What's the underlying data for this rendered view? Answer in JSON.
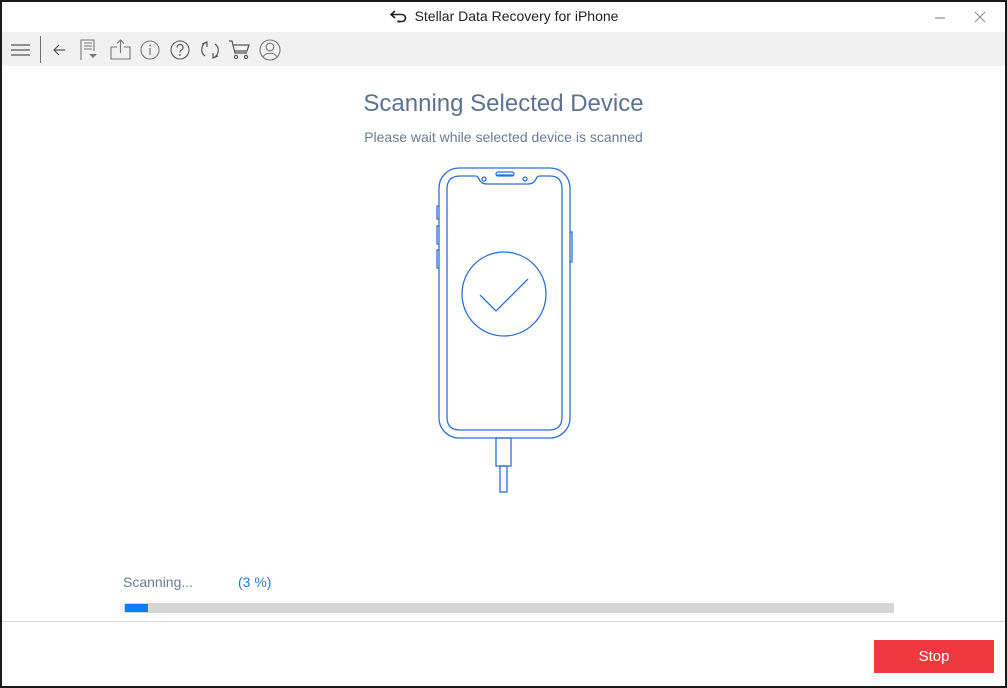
{
  "window": {
    "title": "Stellar Data Recovery for iPhone",
    "controls": [
      "minimize",
      "close"
    ]
  },
  "toolbar": {
    "items": [
      {
        "name": "menu",
        "icon": "hamburger-menu-icon"
      },
      {
        "name": "back",
        "icon": "arrow-left-icon"
      },
      {
        "name": "save-scan",
        "icon": "save-scan-icon"
      },
      {
        "name": "export",
        "icon": "export-icon"
      },
      {
        "name": "info",
        "icon": "info-icon"
      },
      {
        "name": "help",
        "icon": "help-icon"
      },
      {
        "name": "refresh",
        "icon": "refresh-icon"
      },
      {
        "name": "buy",
        "icon": "cart-icon"
      },
      {
        "name": "account",
        "icon": "user-icon"
      }
    ]
  },
  "main": {
    "heading": "Scanning Selected Device",
    "subheading": "Please wait while selected device is scanned",
    "illustration": "iphone-with-checkmark-icon"
  },
  "progress": {
    "label": "Scanning...",
    "percent_text": "(3 %)",
    "value_percent": 3
  },
  "footer": {
    "stop_label": "Stop"
  },
  "colors": {
    "accent_blue": "#0a7cf5",
    "illustration_blue": "#2b6fd6",
    "heading": "#5b7290",
    "stop_red": "#f0393e",
    "progress_track": "#d6d6d6"
  }
}
